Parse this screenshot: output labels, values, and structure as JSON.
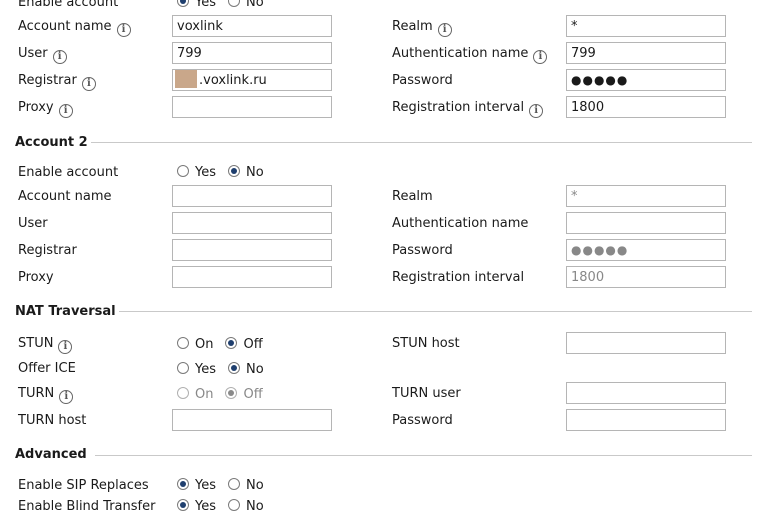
{
  "labels": {
    "enable_account": "Enable account",
    "account_name": "Account name",
    "user": "User",
    "registrar": "Registrar",
    "proxy": "Proxy",
    "realm": "Realm",
    "authentication_name": "Authentication name",
    "password": "Password",
    "registration_interval": "Registration interval",
    "yes": "Yes",
    "no": "No",
    "on": "On",
    "off": "Off"
  },
  "account1": {
    "enable": "yes",
    "account_name": "voxlink",
    "user": "799",
    "registrar_suffix": ".voxlink.ru",
    "proxy": "",
    "realm": "*",
    "authentication_name": "799",
    "password_mask": "●●●●●",
    "registration_interval": "1800"
  },
  "account2": {
    "title": "Account 2",
    "enable": "no",
    "account_name": "",
    "user": "",
    "registrar": "",
    "proxy": "",
    "realm": "*",
    "authentication_name": "",
    "password_mask": "●●●●●",
    "registration_interval": "1800"
  },
  "nat": {
    "title": "NAT Traversal",
    "stun_label": "STUN",
    "stun": "off",
    "stun_host_label": "STUN host",
    "stun_host": "",
    "offer_ice_label": "Offer ICE",
    "offer_ice": "no",
    "turn_label": "TURN",
    "turn": "off",
    "turn_user_label": "TURN user",
    "turn_user": "",
    "turn_host_label": "TURN host",
    "turn_host": "",
    "password_label": "Password",
    "password": ""
  },
  "advanced": {
    "title": "Advanced",
    "sip_replaces_label": "Enable SIP Replaces",
    "sip_replaces": "yes",
    "blind_transfer_label": "Enable Blind Transfer",
    "blind_transfer": "yes"
  }
}
